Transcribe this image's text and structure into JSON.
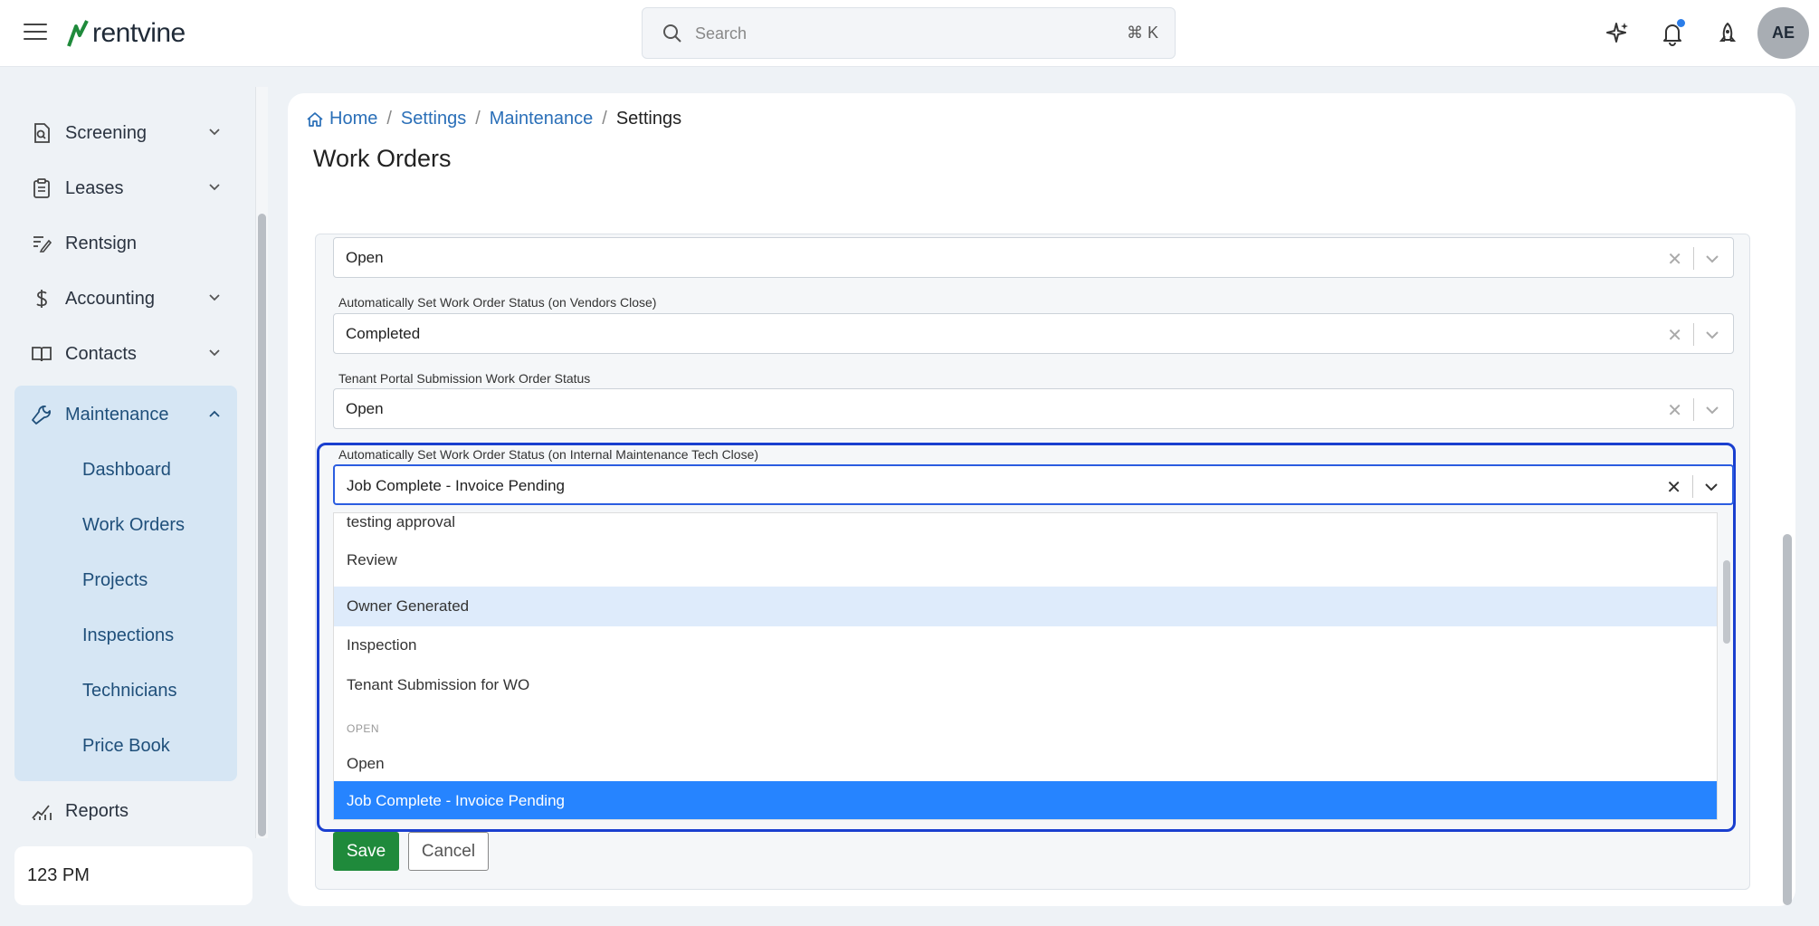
{
  "app": {
    "logo_text": "rentvine"
  },
  "search": {
    "placeholder": "Search",
    "shortcut": "⌘ K"
  },
  "user": {
    "initials": "AE"
  },
  "sidebar": {
    "items": [
      {
        "label": "Screening",
        "icon": "screening-icon",
        "expandable": true
      },
      {
        "label": "Leases",
        "icon": "clipboard-icon",
        "expandable": true
      },
      {
        "label": "Rentsign",
        "icon": "signature-icon",
        "expandable": false
      },
      {
        "label": "Accounting",
        "icon": "dollar-icon",
        "expandable": true
      },
      {
        "label": "Contacts",
        "icon": "book-icon",
        "expandable": true
      },
      {
        "label": "Maintenance",
        "icon": "wrench-icon",
        "expandable": true,
        "expanded": true
      },
      {
        "label": "Reports",
        "icon": "chart-icon",
        "expandable": false
      }
    ],
    "maintenance_sub": [
      "Dashboard",
      "Work Orders",
      "Projects",
      "Inspections",
      "Technicians",
      "Price Book"
    ],
    "status_label": "123 PM"
  },
  "breadcrumb": {
    "home": "Home",
    "settings": "Settings",
    "maintenance": "Maintenance",
    "current": "Settings"
  },
  "page": {
    "title": "Work Orders"
  },
  "form": {
    "field0": {
      "value": "Open"
    },
    "field1": {
      "label": "Automatically Set Work Order Status (on Vendors Close)",
      "value": "Completed"
    },
    "field2": {
      "label": "Tenant Portal Submission Work Order Status",
      "value": "Open"
    },
    "field3": {
      "label": "Automatically Set Work Order Status (on Internal Maintenance Tech Close)",
      "value": "Job Complete - Invoice Pending"
    }
  },
  "dropdown": {
    "options_a": [
      "testing approval",
      "Review",
      "Owner Generated",
      "Inspection",
      "Tenant Submission for WO"
    ],
    "group_label": "OPEN",
    "options_b": [
      "Open",
      "Job Complete - Invoice Pending"
    ],
    "hovered": "Owner Generated",
    "selected": "Job Complete - Invoice Pending"
  },
  "buttons": {
    "save": "Save",
    "cancel": "Cancel"
  },
  "colors": {
    "accent": "#2684ff",
    "save_green": "#1f8a3b",
    "focus_border": "#1a3fcf",
    "link": "#2a6fb8",
    "sidebar_active": "#d6e6f4"
  }
}
